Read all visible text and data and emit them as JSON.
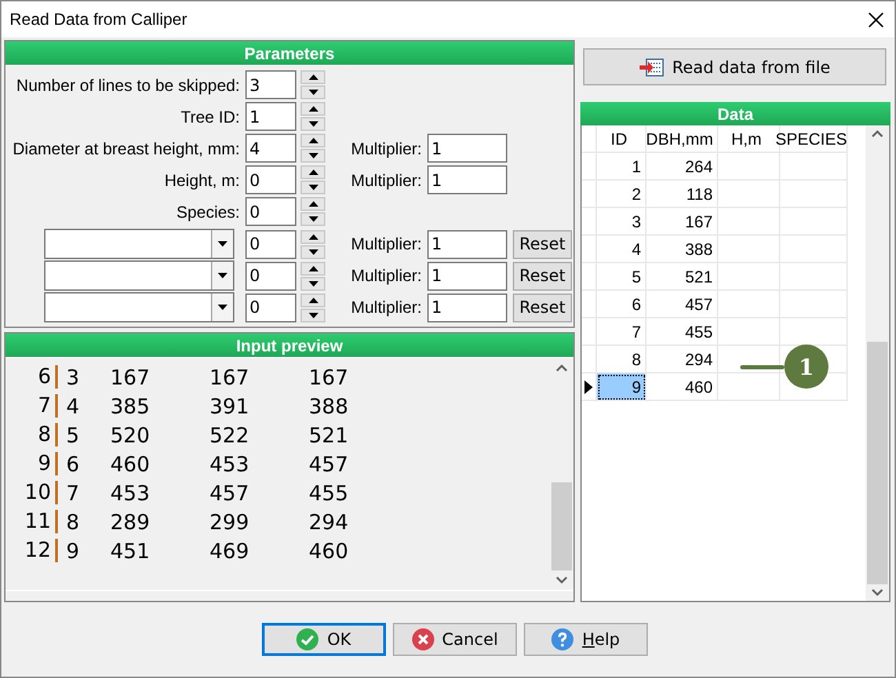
{
  "window": {
    "title": "Read Data from Calliper"
  },
  "parameters": {
    "title": "Parameters",
    "rows": [
      {
        "kind": "spin",
        "label": "Number of lines to be skipped:",
        "value": "3"
      },
      {
        "kind": "spin",
        "label": "Tree ID:",
        "value": "1"
      },
      {
        "kind": "spin_multiplier",
        "label": "Diameter at breast height, mm:",
        "value": "4",
        "multiplier_label": "Multiplier:",
        "multiplier": "1"
      },
      {
        "kind": "spin_multiplier",
        "label": "Height, m:",
        "value": "0",
        "multiplier_label": "Multiplier:",
        "multiplier": "1"
      },
      {
        "kind": "spin",
        "label": "Species:",
        "value": "0"
      },
      {
        "kind": "combo",
        "value": "0",
        "multiplier_label": "Multiplier:",
        "multiplier": "1",
        "reset": "Reset"
      },
      {
        "kind": "combo",
        "value": "0",
        "multiplier_label": "Multiplier:",
        "multiplier": "1",
        "reset": "Reset"
      },
      {
        "kind": "combo",
        "value": "0",
        "multiplier_label": "Multiplier:",
        "multiplier": "1",
        "reset": "Reset"
      }
    ]
  },
  "preview": {
    "title": "Input preview",
    "lines": [
      {
        "number": "6",
        "values": [
          "3",
          "167",
          "167",
          "167"
        ]
      },
      {
        "number": "7",
        "values": [
          "4",
          "385",
          "391",
          "388"
        ]
      },
      {
        "number": "8",
        "values": [
          "5",
          "520",
          "522",
          "521"
        ]
      },
      {
        "number": "9",
        "values": [
          "6",
          "460",
          "453",
          "457"
        ]
      },
      {
        "number": "10",
        "values": [
          "7",
          "453",
          "457",
          "455"
        ]
      },
      {
        "number": "11",
        "values": [
          "8",
          "289",
          "299",
          "294"
        ]
      },
      {
        "number": "12",
        "values": [
          "9",
          "451",
          "469",
          "460"
        ]
      }
    ]
  },
  "read_button": {
    "label": "Read data from file"
  },
  "data": {
    "title": "Data",
    "columns": [
      "ID",
      "DBH,mm",
      "H,m",
      "SPECIES"
    ],
    "rows": [
      {
        "id": "1",
        "dbh": "264",
        "selected": false
      },
      {
        "id": "2",
        "dbh": "118",
        "selected": false
      },
      {
        "id": "3",
        "dbh": "167",
        "selected": false
      },
      {
        "id": "4",
        "dbh": "388",
        "selected": false
      },
      {
        "id": "5",
        "dbh": "521",
        "selected": false
      },
      {
        "id": "6",
        "dbh": "457",
        "selected": false
      },
      {
        "id": "7",
        "dbh": "455",
        "selected": false
      },
      {
        "id": "8",
        "dbh": "294",
        "selected": false
      },
      {
        "id": "9",
        "dbh": "460",
        "selected": true
      }
    ]
  },
  "callout": {
    "label": "1"
  },
  "buttons": [
    {
      "kind": "ok",
      "label": "OK",
      "focused": true
    },
    {
      "kind": "cancel",
      "label": "Cancel",
      "focused": false
    },
    {
      "kind": "help",
      "label": "Help",
      "focused": false
    }
  ]
}
